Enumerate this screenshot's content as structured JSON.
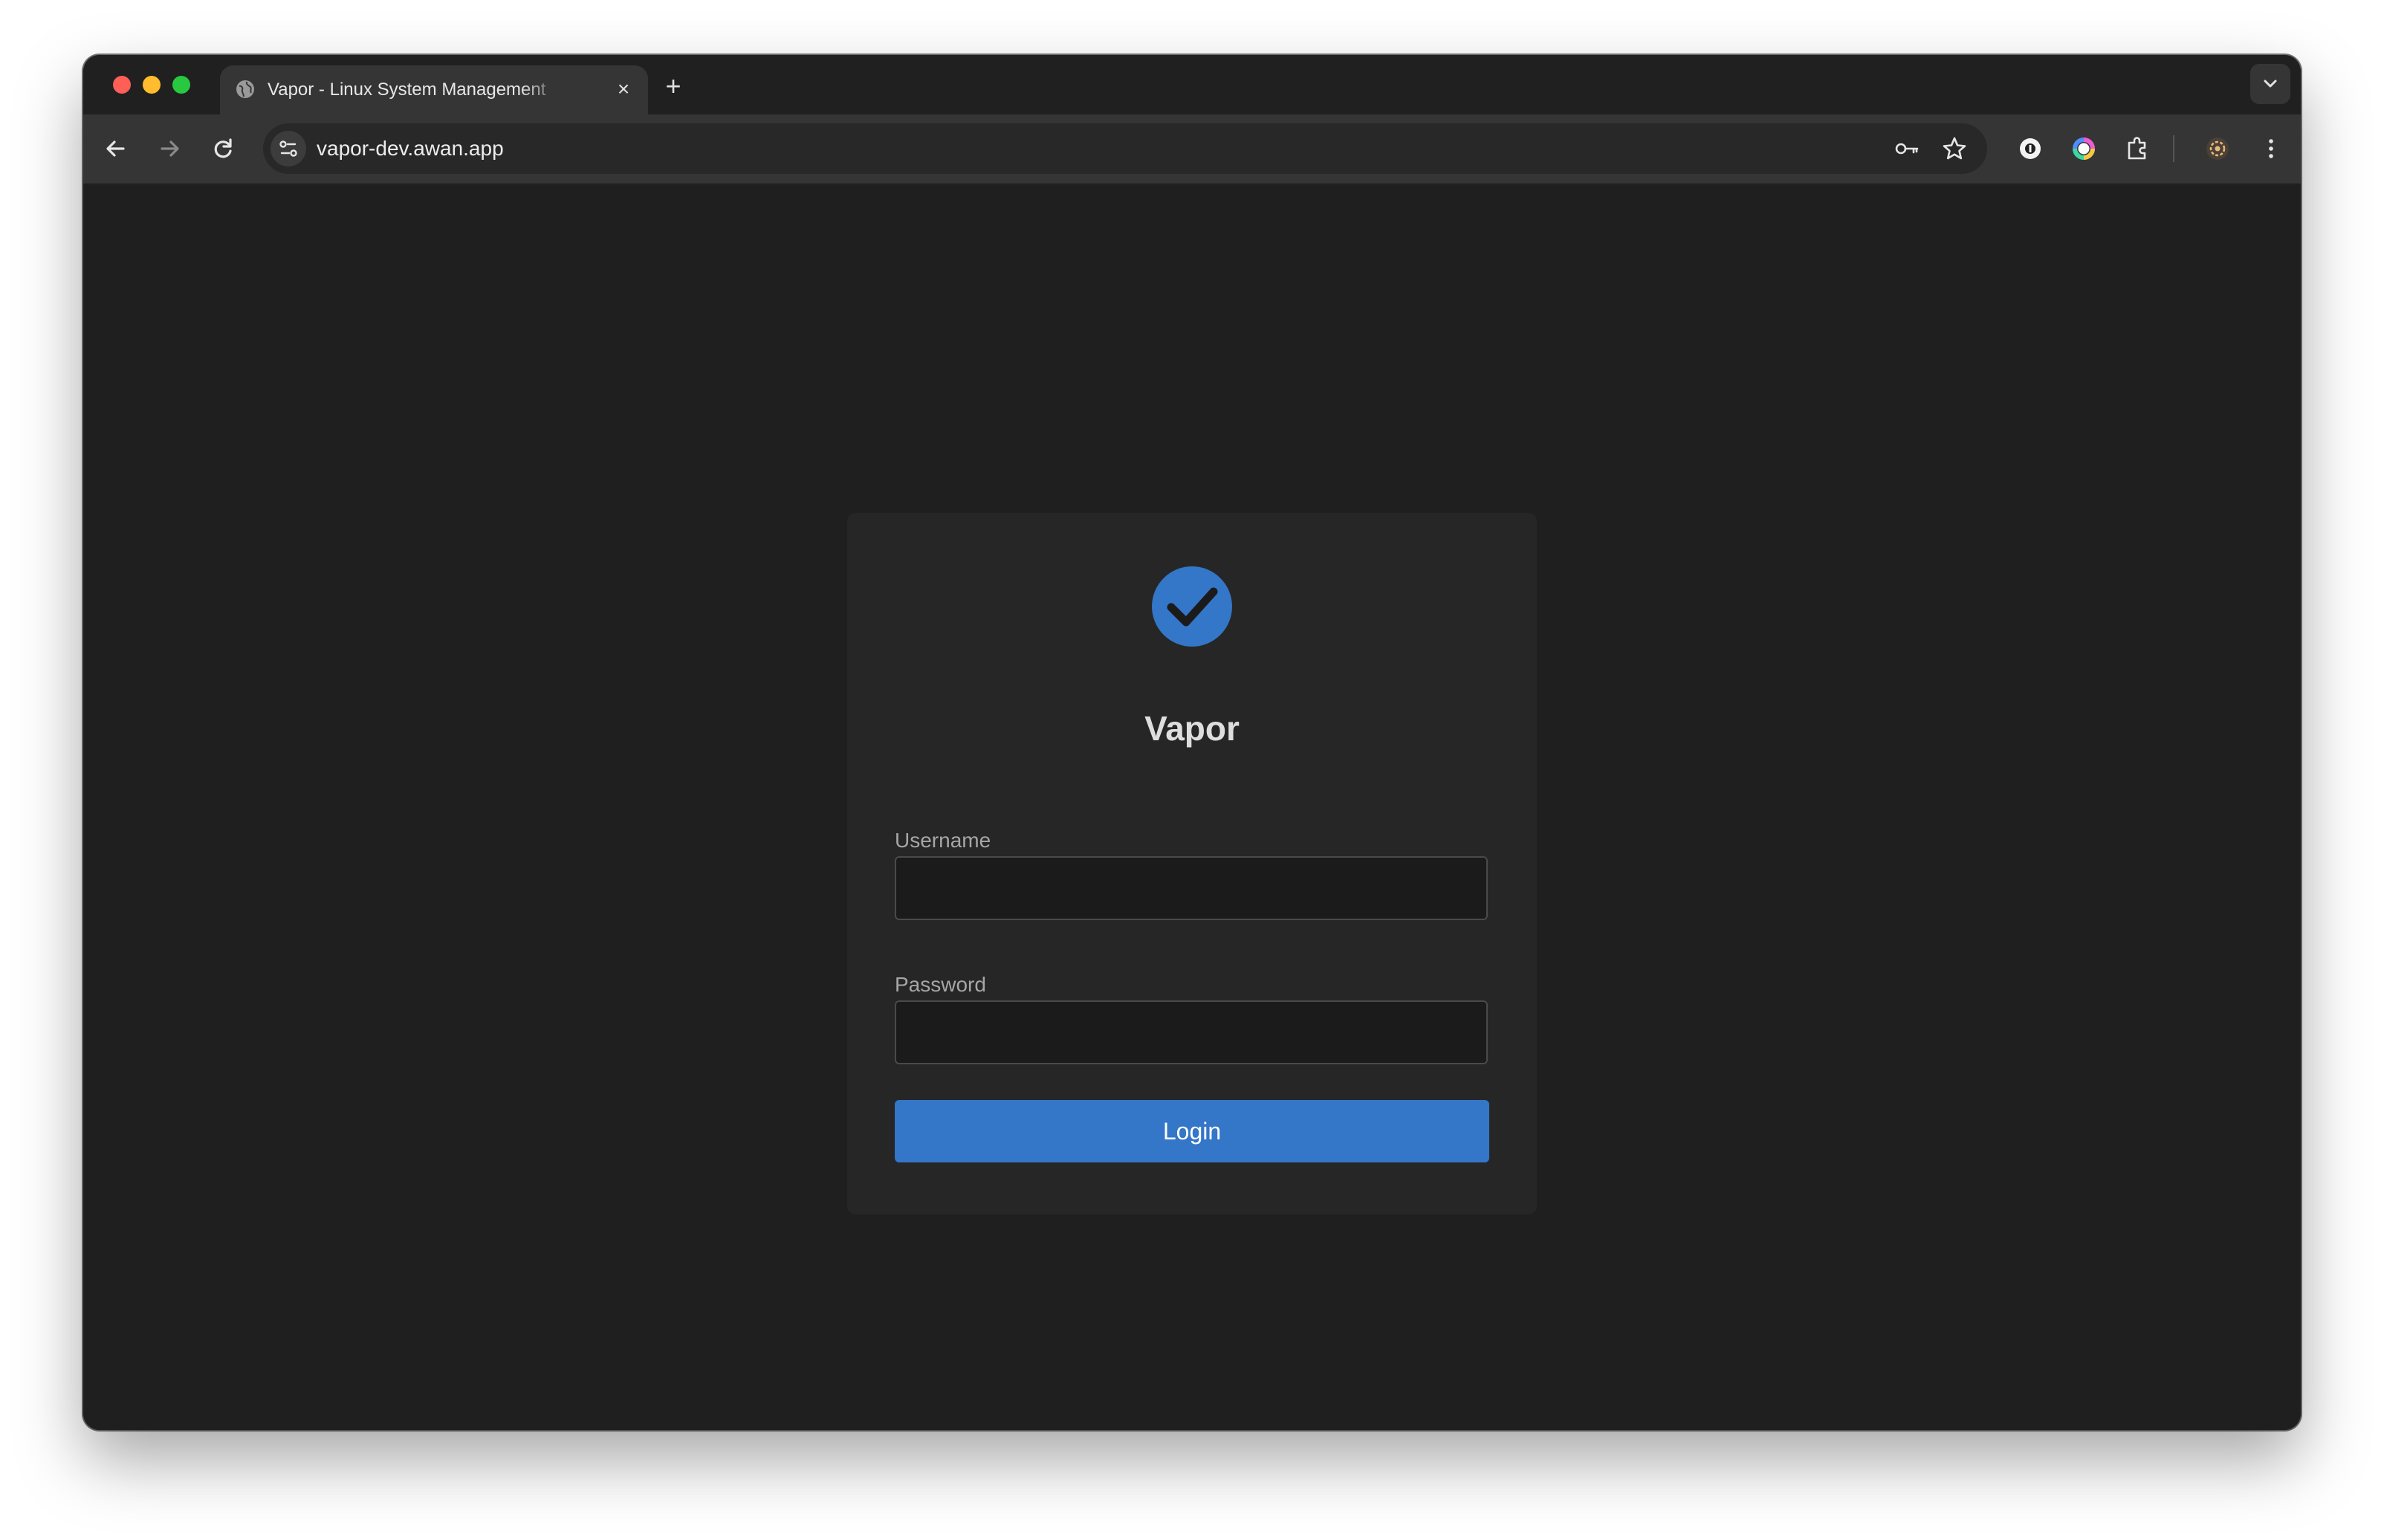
{
  "browser": {
    "tab": {
      "title": "Vapor - Linux System Management",
      "favicon": "globe-icon",
      "close_icon": "×"
    },
    "new_tab_icon": "+",
    "omnibox": {
      "url": "vapor-dev.awan.app",
      "site_info_icon": "tune-icon"
    },
    "toolbar_icons": [
      "back-arrow-icon",
      "forward-arrow-icon",
      "reload-icon",
      "key-icon",
      "star-icon",
      "extension-dark-circle-icon",
      "extension-ring-icon",
      "puzzle-icon",
      "settings-gear-icon",
      "kebab-menu-icon"
    ]
  },
  "login": {
    "logo_icon": "check-circle-icon",
    "app_name": "Vapor",
    "username_label": "Username",
    "username_value": "",
    "password_label": "Password",
    "password_value": "",
    "login_button": "Login"
  },
  "colors": {
    "accent": "#3476c8",
    "page_background": "#1f1f1f",
    "card_background": "#262626"
  }
}
